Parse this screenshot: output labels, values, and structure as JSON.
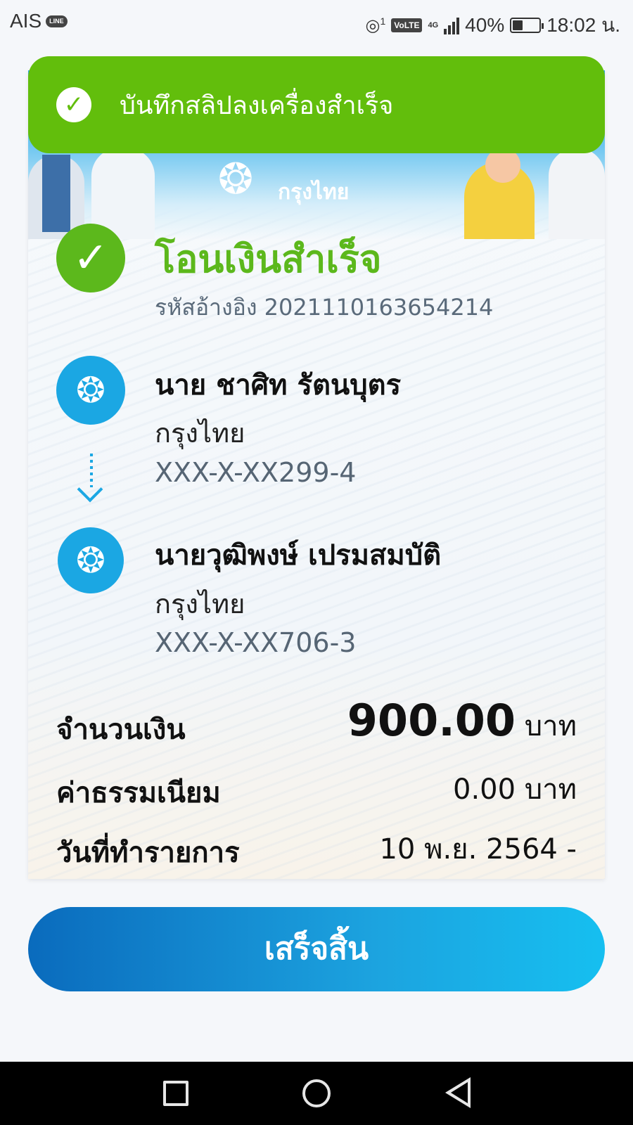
{
  "status_bar": {
    "carrier": "AIS",
    "line_badge": "LINE",
    "hotspot_count": "1",
    "volte": "VoLTE",
    "network": "4G",
    "battery": "40%",
    "time": "18:02 น."
  },
  "banner": {
    "brand_en": "Krungthai",
    "brand_th": "กรุงไทย"
  },
  "toast": {
    "message": "บันทึกสลิปลงเครื่องสำเร็จ"
  },
  "result": {
    "title": "โอนเงินสำเร็จ",
    "reference": "รหัสอ้างอิง 2021110163654214"
  },
  "sender": {
    "name": "นาย ชาศิท รัตนบุตร",
    "bank": "กรุงไทย",
    "account": "XXX-X-XX299-4"
  },
  "receiver": {
    "name": "นายวุฒิพงษ์ เปรมสมบัติ",
    "bank": "กรุงไทย",
    "account": "XXX-X-XX706-3"
  },
  "details": {
    "amount_label": "จำนวนเงิน",
    "amount_value": "900.00",
    "amount_unit": "บาท",
    "fee_label": "ค่าธรรมเนียม",
    "fee_value": "0.00 บาท",
    "date_label": "วันที่ทำรายการ",
    "date_value": "10 พ.ย. 2564 -"
  },
  "actions": {
    "done_label": "เสร็จสิ้น"
  },
  "colors": {
    "success_green": "#5cb81c",
    "toast_green": "#62be0c",
    "brand_blue": "#1ba7e3"
  }
}
